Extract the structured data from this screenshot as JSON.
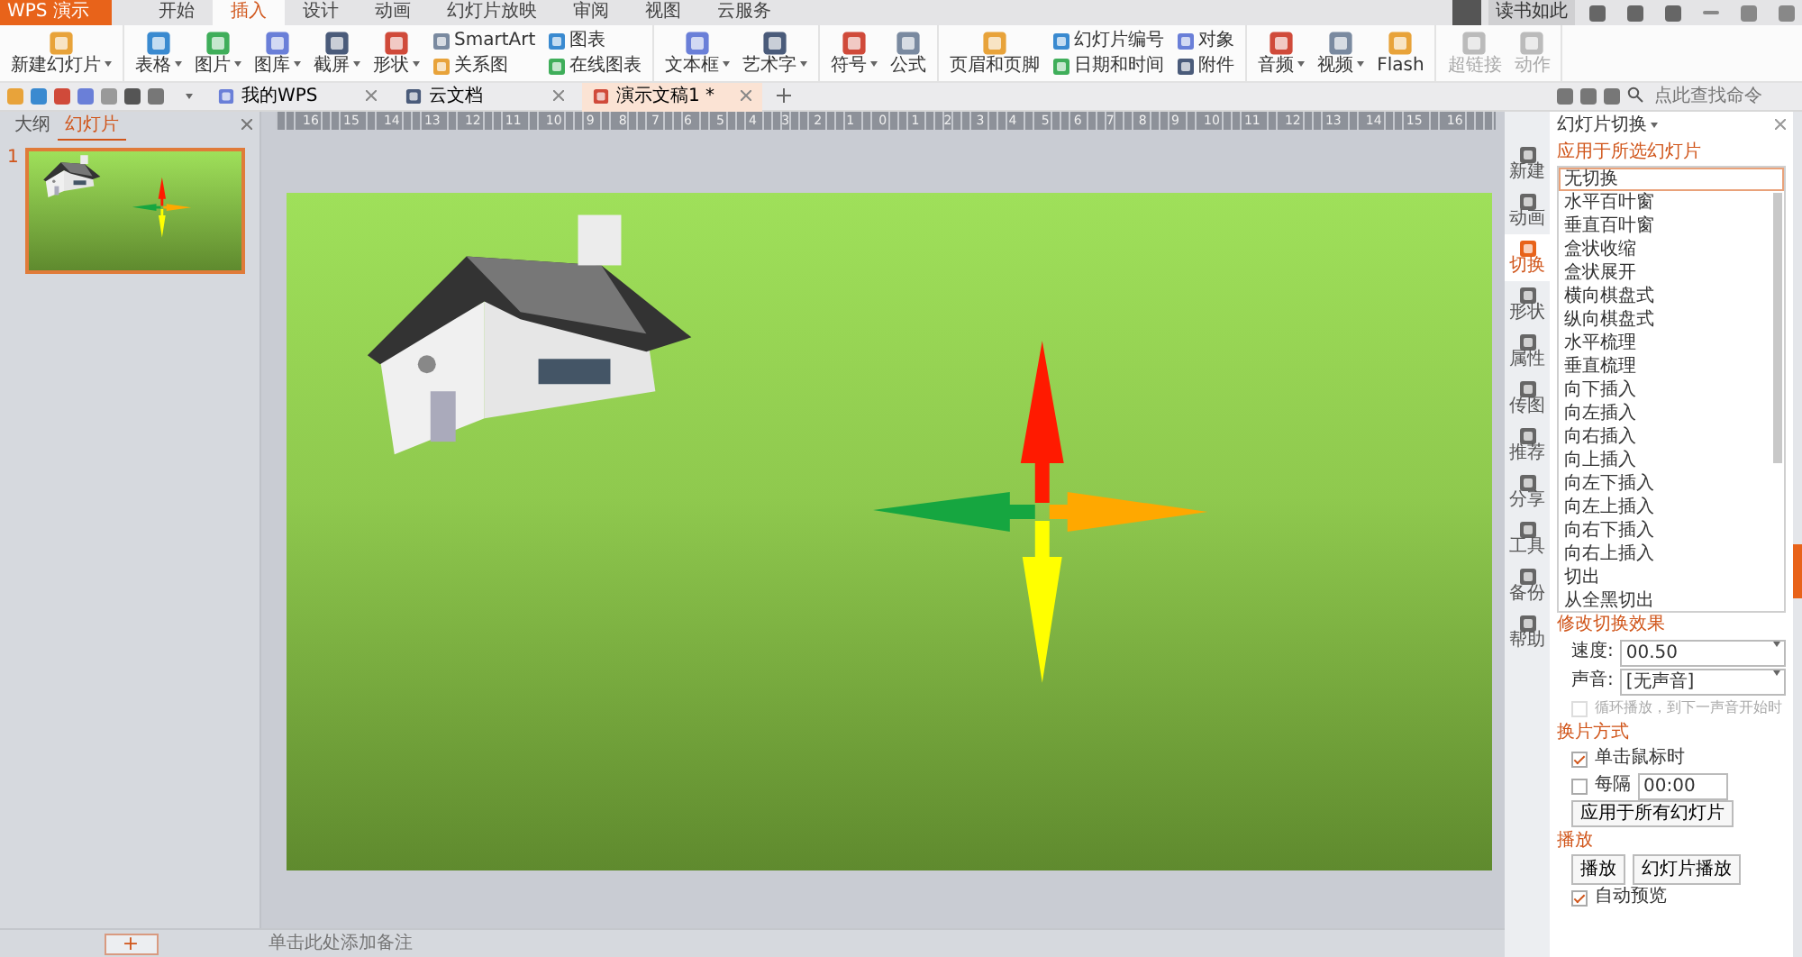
{
  "app_button": {
    "label": "WPS 演示"
  },
  "menu_tabs": [
    {
      "label": "开始",
      "selected": false
    },
    {
      "label": "插入",
      "selected": true
    },
    {
      "label": "设计",
      "selected": false
    },
    {
      "label": "动画",
      "selected": false
    },
    {
      "label": "幻灯片放映",
      "selected": false
    },
    {
      "label": "审阅",
      "selected": false
    },
    {
      "label": "视图",
      "selected": false
    },
    {
      "label": "云服务",
      "selected": false
    }
  ],
  "account": {
    "name": "读书如此"
  },
  "ribbon": {
    "groups": [
      {
        "columns": [
          [
            {
              "label": "新建幻灯片",
              "menu": true,
              "disabled": false
            }
          ]
        ]
      },
      {
        "columns": [
          [
            {
              "label": "表格",
              "menu": true,
              "disabled": false
            }
          ],
          [
            {
              "label": "图片",
              "menu": true,
              "disabled": false
            }
          ],
          [
            {
              "label": "图库",
              "menu": true,
              "disabled": false
            }
          ],
          [
            {
              "label": "截屏",
              "menu": true,
              "disabled": false
            }
          ],
          [
            {
              "label": "形状",
              "menu": true,
              "disabled": false
            }
          ],
          [
            {
              "label": "SmartArt",
              "menu": false,
              "disabled": false
            },
            {
              "label": "关系图",
              "menu": false,
              "disabled": false
            }
          ],
          [
            {
              "label": "图表",
              "menu": false,
              "disabled": false
            },
            {
              "label": "在线图表",
              "menu": false,
              "disabled": false
            }
          ]
        ]
      },
      {
        "columns": [
          [
            {
              "label": "文本框",
              "menu": true,
              "disabled": false
            }
          ],
          [
            {
              "label": "艺术字",
              "menu": true,
              "disabled": false
            }
          ]
        ]
      },
      {
        "columns": [
          [
            {
              "label": "符号",
              "menu": true,
              "disabled": false
            }
          ],
          [
            {
              "label": "公式",
              "menu": false,
              "disabled": false
            }
          ]
        ]
      },
      {
        "columns": [
          [
            {
              "label": "页眉和页脚",
              "menu": false,
              "disabled": false
            }
          ],
          [
            {
              "label": "幻灯片编号",
              "menu": false,
              "disabled": false
            },
            {
              "label": "日期和时间",
              "menu": false,
              "disabled": false
            }
          ],
          [
            {
              "label": "对象",
              "menu": false,
              "disabled": false
            },
            {
              "label": "附件",
              "menu": false,
              "disabled": false
            }
          ]
        ]
      },
      {
        "columns": [
          [
            {
              "label": "音频",
              "menu": true,
              "disabled": false
            }
          ],
          [
            {
              "label": "视频",
              "menu": true,
              "disabled": false
            }
          ],
          [
            {
              "label": "Flash",
              "menu": false,
              "disabled": false
            }
          ]
        ]
      },
      {
        "columns": [
          [
            {
              "label": "超链接",
              "menu": false,
              "disabled": true
            }
          ],
          [
            {
              "label": "动作",
              "menu": false,
              "disabled": true
            }
          ]
        ]
      }
    ]
  },
  "doc_tabs": [
    {
      "label": "我的WPS",
      "selected": false
    },
    {
      "label": "云文档",
      "selected": false
    },
    {
      "label": "演示文稿1 *",
      "selected": true
    }
  ],
  "command_search": {
    "placeholder": "点此查找命令"
  },
  "left_pane": {
    "tabs": [
      {
        "label": "大纲",
        "selected": false
      },
      {
        "label": "幻灯片",
        "selected": true
      }
    ],
    "slides": [
      {
        "number": "1",
        "selected": true
      }
    ]
  },
  "ruler": {
    "labels": [
      "16",
      "15",
      "14",
      "13",
      "12",
      "11",
      "10",
      "9",
      "8",
      "7",
      "6",
      "5",
      "4",
      "3",
      "2",
      "1",
      "0",
      "1",
      "2",
      "3",
      "4",
      "5",
      "6",
      "7",
      "8",
      "9",
      "10",
      "11",
      "12",
      "13",
      "14",
      "15",
      "16"
    ]
  },
  "notes": {
    "placeholder": "单击此处添加备注"
  },
  "add_slide": {
    "label": "+"
  },
  "sidebar": [
    {
      "label": "新建",
      "selected": false
    },
    {
      "label": "动画",
      "selected": false
    },
    {
      "label": "切换",
      "selected": true
    },
    {
      "label": "形状",
      "selected": false
    },
    {
      "label": "属性",
      "selected": false
    },
    {
      "label": "传图",
      "selected": false
    },
    {
      "label": "推荐",
      "selected": false
    },
    {
      "label": "分享",
      "selected": false
    },
    {
      "label": "工具",
      "selected": false
    },
    {
      "label": "备份",
      "selected": false
    },
    {
      "label": "帮助",
      "selected": false
    }
  ],
  "panel": {
    "title": "幻灯片切换",
    "apply_heading": "应用于所选幻灯片",
    "transitions": [
      {
        "label": "无切换",
        "selected": true
      },
      {
        "label": "水平百叶窗",
        "selected": false
      },
      {
        "label": "垂直百叶窗",
        "selected": false
      },
      {
        "label": "盒状收缩",
        "selected": false
      },
      {
        "label": "盒状展开",
        "selected": false
      },
      {
        "label": "横向棋盘式",
        "selected": false
      },
      {
        "label": "纵向棋盘式",
        "selected": false
      },
      {
        "label": "水平梳理",
        "selected": false
      },
      {
        "label": "垂直梳理",
        "selected": false
      },
      {
        "label": "向下插入",
        "selected": false
      },
      {
        "label": "向左插入",
        "selected": false
      },
      {
        "label": "向右插入",
        "selected": false
      },
      {
        "label": "向上插入",
        "selected": false
      },
      {
        "label": "向左下插入",
        "selected": false
      },
      {
        "label": "向左上插入",
        "selected": false
      },
      {
        "label": "向右下插入",
        "selected": false
      },
      {
        "label": "向右上插入",
        "selected": false
      },
      {
        "label": "切出",
        "selected": false
      },
      {
        "label": "从全黑切出",
        "selected": false
      }
    ],
    "modify_heading": "修改切换效果",
    "speed": {
      "label": "速度:",
      "value": "00.50"
    },
    "sound": {
      "label": "声音:",
      "value": "[无声音]"
    },
    "loop": {
      "label": "循环播放，到下一声音开始时",
      "checked": false,
      "disabled": true
    },
    "advance_heading": "换片方式",
    "advance": [
      {
        "label": "单击鼠标时",
        "checked": true
      },
      {
        "label": "每隔",
        "checked": false,
        "value": "00:00"
      }
    ],
    "apply_all": "应用于所有幻灯片",
    "play_heading": "播放",
    "play_buttons": [
      "播放",
      "幻灯片播放"
    ],
    "autopreview": {
      "label": "自动预览",
      "checked": true
    }
  }
}
